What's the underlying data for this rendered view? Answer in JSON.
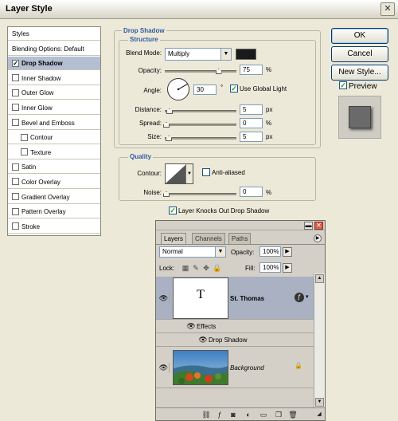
{
  "window": {
    "title": "Layer Style",
    "close_glyph": "✕"
  },
  "styles_list": [
    {
      "label": "Styles",
      "checkbox": false,
      "checked": false,
      "selected": false,
      "sub": false
    },
    {
      "label": "Blending Options: Default",
      "checkbox": false,
      "checked": false,
      "selected": false,
      "sub": false
    },
    {
      "label": "Drop Shadow",
      "checkbox": true,
      "checked": true,
      "selected": true,
      "sub": false
    },
    {
      "label": "Inner Shadow",
      "checkbox": true,
      "checked": false,
      "selected": false,
      "sub": false
    },
    {
      "label": "Outer Glow",
      "checkbox": true,
      "checked": false,
      "selected": false,
      "sub": false
    },
    {
      "label": "Inner Glow",
      "checkbox": true,
      "checked": false,
      "selected": false,
      "sub": false
    },
    {
      "label": "Bevel and Emboss",
      "checkbox": true,
      "checked": false,
      "selected": false,
      "sub": false
    },
    {
      "label": "Contour",
      "checkbox": true,
      "checked": false,
      "selected": false,
      "sub": true
    },
    {
      "label": "Texture",
      "checkbox": true,
      "checked": false,
      "selected": false,
      "sub": true
    },
    {
      "label": "Satin",
      "checkbox": true,
      "checked": false,
      "selected": false,
      "sub": false
    },
    {
      "label": "Color Overlay",
      "checkbox": true,
      "checked": false,
      "selected": false,
      "sub": false
    },
    {
      "label": "Gradient Overlay",
      "checkbox": true,
      "checked": false,
      "selected": false,
      "sub": false
    },
    {
      "label": "Pattern Overlay",
      "checkbox": true,
      "checked": false,
      "selected": false,
      "sub": false
    },
    {
      "label": "Stroke",
      "checkbox": true,
      "checked": false,
      "selected": false,
      "sub": false
    }
  ],
  "drop_shadow": {
    "title": "Drop Shadow",
    "structure_title": "Structure",
    "blend_mode_label": "Blend Mode:",
    "blend_mode_value": "Multiply",
    "shadow_color": "#1a1a1a",
    "opacity_label": "Opacity:",
    "opacity_value": "75",
    "opacity_unit": "%",
    "opacity_level": 0.75,
    "angle_label": "Angle:",
    "angle_value": "30",
    "angle_unit": "°",
    "use_global_light_label": "Use Global Light",
    "use_global_light_checked": true,
    "distance_label": "Distance:",
    "distance_value": "5",
    "distance_unit": "px",
    "spread_label": "Spread:",
    "spread_value": "0",
    "spread_unit": "%",
    "size_label": "Size:",
    "size_value": "5",
    "size_unit": "px",
    "quality_title": "Quality",
    "contour_label": "Contour:",
    "anti_aliased_label": "Anti-aliased",
    "anti_aliased_checked": false,
    "noise_label": "Noise:",
    "noise_value": "0",
    "noise_unit": "%",
    "knockout_label": "Layer Knocks Out Drop Shadow",
    "knockout_checked": true
  },
  "buttons": {
    "ok": "OK",
    "cancel": "Cancel",
    "new_style": "New Style...",
    "preview_label": "Preview",
    "preview_checked": true
  },
  "layers_panel": {
    "tabs": [
      "Layers",
      "Channels",
      "Paths"
    ],
    "active_tab": "Layers",
    "blend_mode": "Normal",
    "opacity_label": "Opacity:",
    "opacity_value": "100%",
    "lock_label": "Lock:",
    "fill_label": "Fill:",
    "fill_value": "100%",
    "layers": [
      {
        "name": "St. Thomas",
        "thumb_text": "T",
        "active": true
      },
      {
        "name": "Background",
        "active": false
      }
    ],
    "effects_label": "Effects",
    "effect_item": "Drop Shadow"
  }
}
